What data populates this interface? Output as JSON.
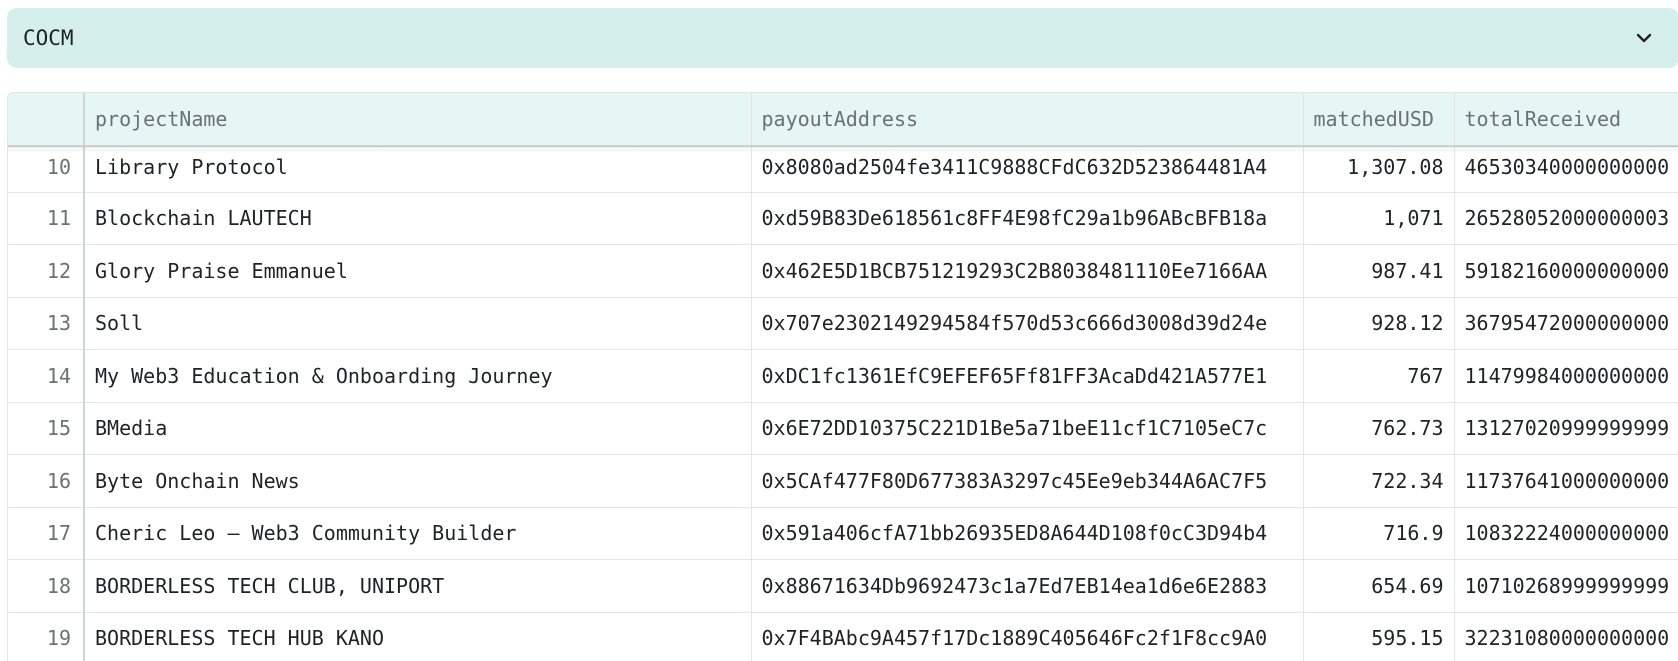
{
  "selector": {
    "value": "COCM",
    "icon": "chevron-down-icon"
  },
  "table": {
    "columns": [
      "projectName",
      "payoutAddress",
      "matchedUSD",
      "totalReceived"
    ],
    "rows": [
      {
        "index": "10",
        "projectName": "Library Protocol",
        "payoutAddress": "0x8080ad2504fe3411C9888CFdC632D523864481A4",
        "matchedUSD": "1,307.08",
        "totalReceived": "46530340000000000"
      },
      {
        "index": "11",
        "projectName": "Blockchain LAUTECH",
        "payoutAddress": "0xd59B83De618561c8FF4E98fC29a1b96ABcBFB18a",
        "matchedUSD": "1,071",
        "totalReceived": "26528052000000003"
      },
      {
        "index": "12",
        "projectName": "Glory Praise Emmanuel",
        "payoutAddress": "0x462E5D1BCB751219293C2B8038481110Ee7166AA",
        "matchedUSD": "987.41",
        "totalReceived": "59182160000000000"
      },
      {
        "index": "13",
        "projectName": "Soll",
        "payoutAddress": "0x707e2302149294584f570d53c666d3008d39d24e",
        "matchedUSD": "928.12",
        "totalReceived": "36795472000000000"
      },
      {
        "index": "14",
        "projectName": "My Web3 Education & Onboarding Journey",
        "payoutAddress": "0xDC1fc1361EfC9EFEF65Ff81FF3AcaDd421A577E1",
        "matchedUSD": "767",
        "totalReceived": "11479984000000000"
      },
      {
        "index": "15",
        "projectName": "BMedia",
        "payoutAddress": "0x6E72DD10375C221D1Be5a71beE11cf1C7105eC7c",
        "matchedUSD": "762.73",
        "totalReceived": "13127020999999999"
      },
      {
        "index": "16",
        "projectName": "Byte Onchain News",
        "payoutAddress": "0x5CAf477F80D677383A3297c45Ee9eb344A6AC7F5",
        "matchedUSD": "722.34",
        "totalReceived": "11737641000000000"
      },
      {
        "index": "17",
        "projectName": "Cheric Leo – Web3 Community Builder",
        "payoutAddress": "0x591a406cfA71bb26935ED8A644D108f0cC3D94b4",
        "matchedUSD": "716.9",
        "totalReceived": "10832224000000000"
      },
      {
        "index": "18",
        "projectName": "BORDERLESS TECH CLUB, UNIPORT",
        "payoutAddress": "0x88671634Db9692473c1a7Ed7EB14ea1d6e6E2883",
        "matchedUSD": "654.69",
        "totalReceived": "10710268999999999"
      },
      {
        "index": "19",
        "projectName": "BORDERLESS TECH HUB KANO",
        "payoutAddress": "0x7F4BAbc9A457f17Dc1889C405646Fc2f1F8cc9A0",
        "matchedUSD": "595.15",
        "totalReceived": "32231080000000000"
      }
    ]
  }
}
